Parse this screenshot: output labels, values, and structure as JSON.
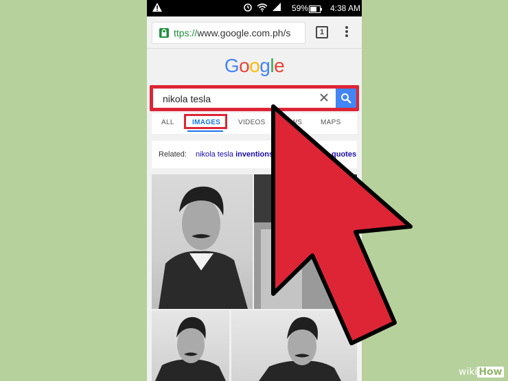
{
  "status_bar": {
    "battery_percent": "59%",
    "time": "4:38 AM",
    "icons": [
      "warning-icon",
      "alarm-icon",
      "wifi-icon",
      "signal-icon",
      "battery-icon"
    ]
  },
  "browser": {
    "url_scheme": "ttps://",
    "url_rest": "www.google.com.ph/s",
    "tab_count": "1"
  },
  "google": {
    "logo_letters": [
      {
        "ch": "G",
        "color": "#4285f4"
      },
      {
        "ch": "o",
        "color": "#ea4335"
      },
      {
        "ch": "o",
        "color": "#fbbc05"
      },
      {
        "ch": "g",
        "color": "#4285f4"
      },
      {
        "ch": "l",
        "color": "#34a853"
      },
      {
        "ch": "e",
        "color": "#ea4335"
      }
    ],
    "query": "nikola tesla",
    "tabs": [
      "ALL",
      "IMAGES",
      "VIDEOS",
      "NEWS",
      "MAPS"
    ],
    "active_tab": "IMAGES",
    "related_label": "Related:",
    "related_link_prefix": "nikola tesla ",
    "related_link_bold": "inventions",
    "related_link2": "quotes"
  },
  "watermark": {
    "wiki": "wiki",
    "how": "How"
  },
  "colors": {
    "highlight": "#dd2536",
    "background": "#b6d19c",
    "search_button": "#4285f4"
  }
}
